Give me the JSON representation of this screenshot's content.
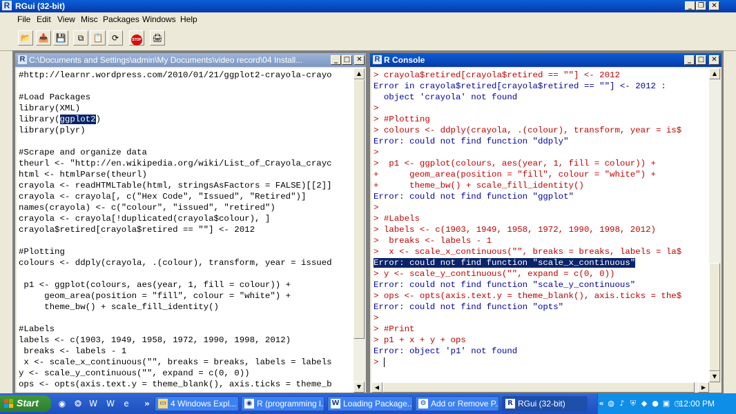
{
  "app": {
    "title": "RGui (32-bit)",
    "logo": "R"
  },
  "menu": [
    "File",
    "Edit",
    "View",
    "Misc",
    "Packages",
    "Windows",
    "Help"
  ],
  "toolbar": {
    "icons": [
      "open-script-icon",
      "load-workspace-icon",
      "save-icon",
      "copy-icon",
      "paste-icon",
      "copy-paste-icon",
      "stop-icon",
      "print-icon"
    ],
    "stop_label": "STOP"
  },
  "editor": {
    "title": "C:\\Documents and Settings\\admin\\My Documents\\video record\\04 Install...",
    "lines": [
      "#http://learnr.wordpress.com/2010/01/21/ggplot2-crayola-crayo",
      "",
      "#Load Packages",
      "library(XML)",
      "",
      "library(plyr)",
      "",
      "#Scrape and organize data",
      "theurl <- \"http://en.wikipedia.org/wiki/List_of_Crayola_crayc",
      "html <- htmlParse(theurl)",
      "crayola <- readHTMLTable(html, stringsAsFactors = FALSE)[[2]]",
      "crayola <- crayola[, c(\"Hex Code\", \"Issued\", \"Retired\")]",
      "names(crayola) <- c(\"colour\", \"issued\", \"retired\")",
      "crayola <- crayola[!duplicated(crayola$colour), ]",
      "crayola$retired[crayola$retired == \"\"] <- 2012",
      "",
      "#Plotting",
      "colours <- ddply(crayola, .(colour), transform, year = issued",
      "",
      " p1 <- ggplot(colours, aes(year, 1, fill = colour)) +",
      "     geom_area(position = \"fill\", colour = \"white\") +",
      "     theme_bw() + scale_fill_identity()",
      "",
      "#Labels",
      "labels <- c(1903, 1949, 1958, 1972, 1990, 1998, 2012)",
      " breaks <- labels - 1",
      " x <- scale_x_continuous(\"\", breaks = breaks, labels = labels",
      "y <- scale_y_continuous(\"\", expand = c(0, 0))",
      "ops <- opts(axis.text.y = theme_blank(), axis.ticks = theme_b"
    ],
    "selected_line": {
      "prefix": "library(",
      "selection": "ggplot2",
      "suffix": ")"
    }
  },
  "console": {
    "title": "R Console",
    "lines": [
      {
        "t": "> crayola$retired[crayola$retired == \"\"] <- 2012",
        "c": "in"
      },
      {
        "t": "Error in crayola$retired[crayola$retired == \"\"] <- 2012 :",
        "c": "out"
      },
      {
        "t": "  object 'crayola' not found",
        "c": "out"
      },
      {
        "t": ">",
        "c": "in"
      },
      {
        "t": "> #Plotting",
        "c": "in"
      },
      {
        "t": "> colours <- ddply(crayola, .(colour), transform, year = is$",
        "c": "in"
      },
      {
        "t": "Error: could not find function \"ddply\"",
        "c": "out"
      },
      {
        "t": ">",
        "c": "in"
      },
      {
        "t": ">  p1 <- ggplot(colours, aes(year, 1, fill = colour)) +",
        "c": "in"
      },
      {
        "t": "+      geom_area(position = \"fill\", colour = \"white\") +",
        "c": "in"
      },
      {
        "t": "+      theme_bw() + scale_fill_identity()",
        "c": "in"
      },
      {
        "t": "Error: could not find function \"ggplot\"",
        "c": "out"
      },
      {
        "t": ">",
        "c": "in"
      },
      {
        "t": "> #Labels",
        "c": "in"
      },
      {
        "t": "> labels <- c(1903, 1949, 1958, 1972, 1990, 1998, 2012)",
        "c": "in"
      },
      {
        "t": ">  breaks <- labels - 1",
        "c": "in"
      },
      {
        "t": ">  x <- scale_x_continuous(\"\", breaks = breaks, labels = la$",
        "c": "in"
      },
      {
        "t": "Error: could not find function \"scale_x_continuous\"",
        "c": "hl"
      },
      {
        "t": "> y <- scale_y_continuous(\"\", expand = c(0, 0))",
        "c": "in"
      },
      {
        "t": "Error: could not find function \"scale_y_continuous\"",
        "c": "out"
      },
      {
        "t": "> ops <- opts(axis.text.y = theme_blank(), axis.ticks = the$",
        "c": "in"
      },
      {
        "t": "Error: could not find function \"opts\"",
        "c": "out"
      },
      {
        "t": ">",
        "c": "in"
      },
      {
        "t": "> #Print",
        "c": "in"
      },
      {
        "t": "> p1 + x + y + ops",
        "c": "in"
      },
      {
        "t": "Error: object 'p1' not found",
        "c": "out"
      },
      {
        "t": "> ",
        "c": "in"
      }
    ],
    "colors": {
      "input": "#c00000",
      "output": "#0000a0",
      "highlight_bg": "#0a246a"
    }
  },
  "taskbar": {
    "start": "Start",
    "more_glyph": "»",
    "quicklaunch": [
      "chrome-icon",
      "firefox-icon",
      "word-icon",
      "ie-icon"
    ],
    "tasks": [
      {
        "label": "4 Windows Expl... ▾",
        "icon": "folder-icon"
      },
      {
        "label": "R (programming l...",
        "icon": "chrome-icon"
      },
      {
        "label": "Loading Package...",
        "icon": "word-icon"
      },
      {
        "label": "Add or Remove P...",
        "icon": "control-panel-icon"
      },
      {
        "label": "RGui (32-bit)",
        "icon": "r-icon",
        "active": true
      }
    ],
    "clock": "12:00 PM"
  }
}
